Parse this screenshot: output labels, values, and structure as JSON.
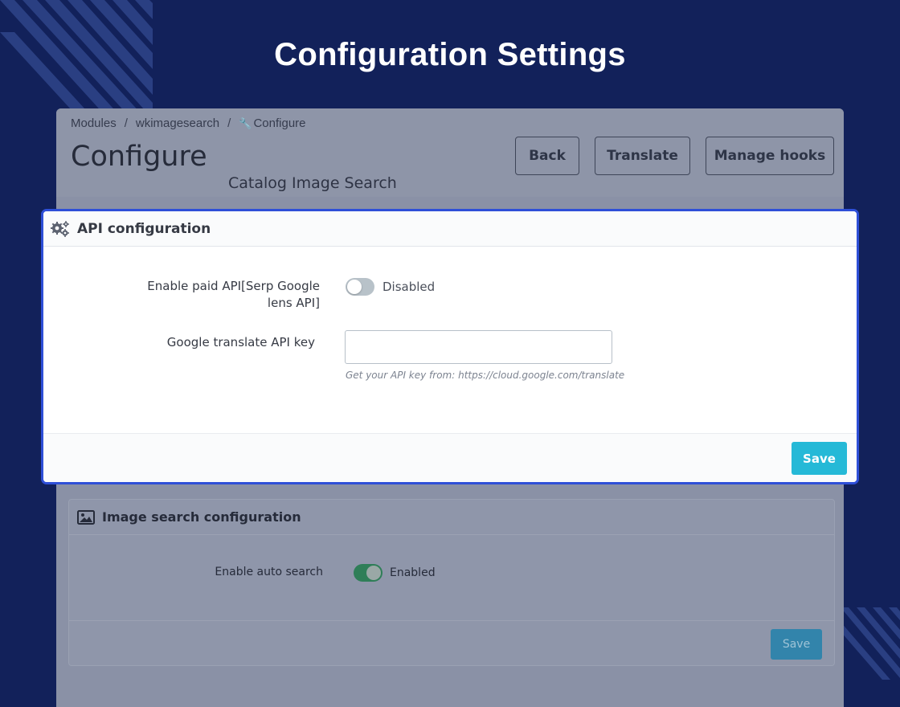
{
  "page": {
    "title": "Configuration Settings"
  },
  "admin": {
    "breadcrumb": [
      "Modules",
      "wkimagesearch",
      "Configure"
    ],
    "breadcrumb_sep": "/",
    "heading": "Configure",
    "module_name": "Catalog Image Search",
    "buttons": {
      "back": "Back",
      "translate": "Translate",
      "manage_hooks": "Manage hooks"
    }
  },
  "api_panel": {
    "title": "API configuration",
    "icon": "cogs-icon",
    "paid_api": {
      "label": "Enable paid API[Serp Google lens API]",
      "state_label": "Disabled",
      "enabled": false
    },
    "google_key": {
      "label": "Google translate API key",
      "value": "",
      "help": "Get your API key from: https://cloud.google.com/translate"
    },
    "save_label": "Save",
    "accent": "#2e4fd8",
    "save_color": "#25b9d7"
  },
  "image_panel": {
    "title": "Image search configuration",
    "icon": "image-icon",
    "auto_search": {
      "label": "Enable auto search",
      "state_label": "Enabled",
      "enabled": true
    },
    "save_label": "Save"
  }
}
